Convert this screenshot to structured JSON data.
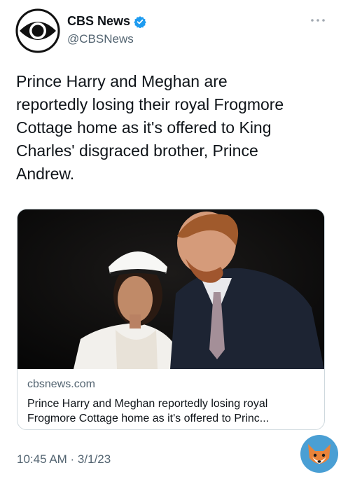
{
  "author": {
    "display_name": "CBS News",
    "handle": "@CBSNews",
    "avatar_icon": "cbs-eye-logo",
    "verified_icon": "verified-badge-icon",
    "verified_color": "#1d9bf0"
  },
  "more_icon": "more-dots-icon",
  "tweet": {
    "lines": [
      "Prince Harry and Meghan are",
      "reportedly losing their royal Frogmore",
      "Cottage home as it's offered to King",
      "Charles' disgraced brother, Prince",
      "Andrew."
    ]
  },
  "card": {
    "image_icon": "article-photo",
    "domain": "cbsnews.com",
    "title_lines": [
      "Prince Harry and Meghan reportedly losing royal",
      "Frogmore Cottage home as it's offered to Princ..."
    ]
  },
  "timestamp": "10:45 AM · 3/1/23",
  "watermark_icon": "fox-logo",
  "colors": {
    "text_primary": "#0f1419",
    "text_secondary": "#536471",
    "border": "#cfd9de"
  }
}
